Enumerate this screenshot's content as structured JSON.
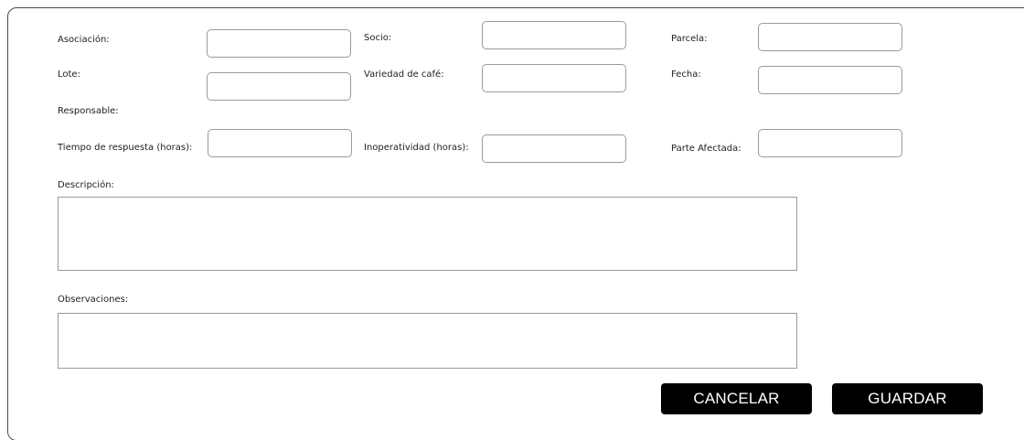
{
  "form": {
    "asociacion": {
      "label": "Asociación:",
      "value": ""
    },
    "socio": {
      "label": "Socio:",
      "value": ""
    },
    "parcela": {
      "label": "Parcela:",
      "value": ""
    },
    "lote": {
      "label": "Lote:",
      "value": ""
    },
    "variedad": {
      "label": "Variedad de café:",
      "value": ""
    },
    "fecha": {
      "label": "Fecha:",
      "value": ""
    },
    "responsable": {
      "label": "Responsable:"
    },
    "tiempo_respuesta": {
      "label": "Tiempo de respuesta (horas):",
      "value": ""
    },
    "inoperatividad": {
      "label": "Inoperatividad (horas):",
      "value": ""
    },
    "parte_afectada": {
      "label": "Parte Afectada:",
      "value": ""
    },
    "descripcion": {
      "label": "Descripción:",
      "value": ""
    },
    "observaciones": {
      "label": "Observaciones:",
      "value": ""
    }
  },
  "actions": {
    "cancel_label": "CANCELAR",
    "save_label": "GUARDAR"
  }
}
